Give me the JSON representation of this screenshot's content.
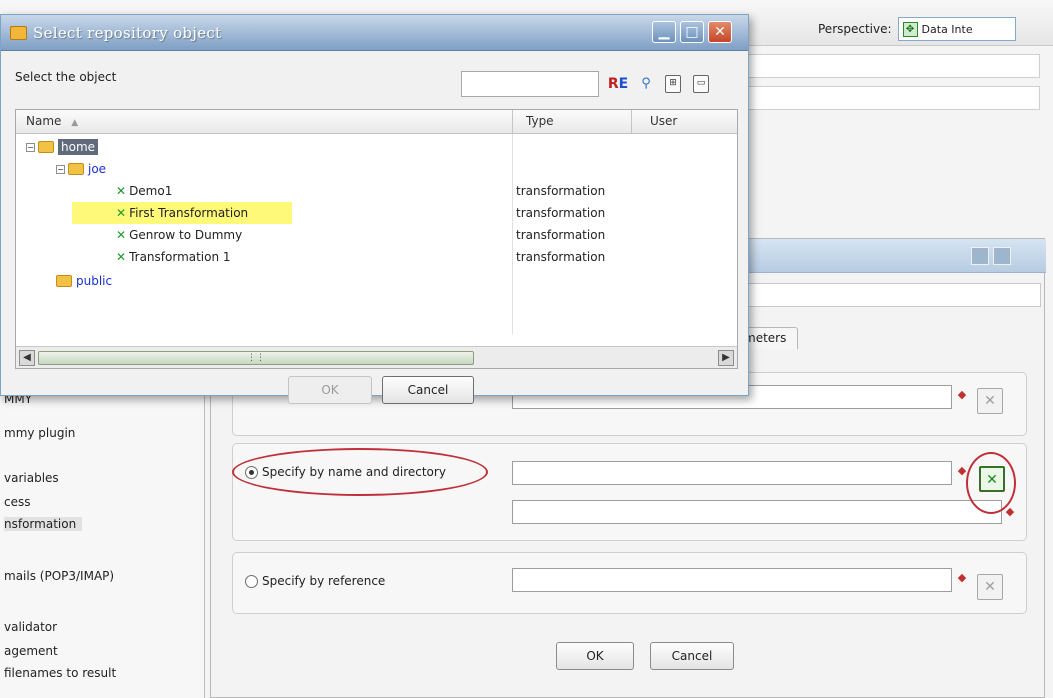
{
  "app": {
    "perspective_label": "Perspective:",
    "perspective_value": "Data Inte"
  },
  "palette": {
    "items": [
      "MMY",
      "mmy plugin",
      "variables",
      "cess",
      "nsformation",
      "mails (POP3/IMAP)",
      "validator",
      "agement",
      "filenames to result"
    ]
  },
  "job_dialog": {
    "params_tab": "meters",
    "radio_name_dir": "Specify by name and directory",
    "radio_reference": "Specify by reference",
    "ok_label": "OK",
    "cancel_label": "Cancel"
  },
  "repo_dialog": {
    "title": "Select repository object",
    "prompt": "Select the object",
    "search_value": "",
    "toolbar": {
      "re_icon": "regex-icon",
      "search_icon": "magnifier-icon",
      "expand_icon": "expand-icon",
      "collapse_icon": "collapse-icon"
    },
    "columns": [
      "Name",
      "Type",
      "User"
    ],
    "sort_indicator": "▲",
    "tree": [
      {
        "label": "home",
        "kind": "folder",
        "type": ""
      },
      {
        "label": "joe",
        "kind": "folder",
        "type": ""
      },
      {
        "label": "Demo1",
        "kind": "transformation",
        "type": "transformation"
      },
      {
        "label": "First Transformation",
        "kind": "transformation",
        "type": "transformation"
      },
      {
        "label": "Genrow to Dummy",
        "kind": "transformation",
        "type": "transformation"
      },
      {
        "label": "Transformation 1",
        "kind": "transformation",
        "type": "transformation"
      },
      {
        "label": "public",
        "kind": "folder",
        "type": ""
      }
    ],
    "ok_label": "OK",
    "cancel_label": "Cancel"
  },
  "colors": {
    "highlight": "#fff97a",
    "folder_link": "#1a2fd0",
    "annotation_red": "#c0303a",
    "transformation_green": "#1e9a2a"
  }
}
